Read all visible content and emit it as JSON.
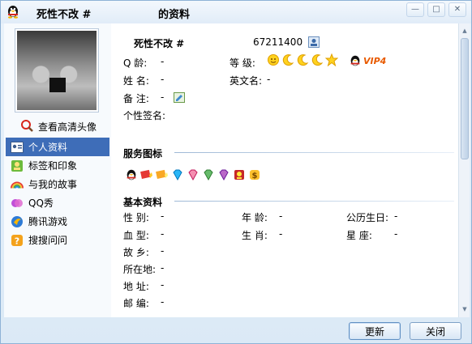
{
  "window": {
    "title_name": "死性不改  #",
    "title_suffix": "的资料",
    "minimize_glyph": "—",
    "maximize_glyph": "□",
    "close_glyph": "✕"
  },
  "sidebar": {
    "view_hd_avatar": "查看高清头像",
    "items": [
      {
        "label": "个人资料",
        "icon": "profile-card-icon",
        "active": true
      },
      {
        "label": "标签和印象",
        "icon": "tag-icon",
        "active": false
      },
      {
        "label": "与我的故事",
        "icon": "rainbow-icon",
        "active": false
      },
      {
        "label": "QQ秀",
        "icon": "qq-show-icon",
        "active": false
      },
      {
        "label": "腾讯游戏",
        "icon": "game-icon",
        "active": false
      },
      {
        "label": "搜搜问问",
        "icon": "question-icon",
        "active": false
      }
    ]
  },
  "profile": {
    "nickname": "死性不改  #",
    "qq_number": "67211400",
    "fields": {
      "age_label": "Q    龄:",
      "age_value": "-",
      "level_label": "等    级:",
      "vip_label": "VIP4",
      "name_label": "姓    名:",
      "name_value": "-",
      "english_name_label": "英文名:",
      "english_name_value": "-",
      "remark_label": "备    注:",
      "remark_value": "-",
      "signature_label": "个性签名:"
    }
  },
  "sections": {
    "service_icons": "服务图标",
    "basic_info": "基本资料"
  },
  "basic_info": {
    "gender_label": "性    别:",
    "gender_value": "-",
    "age_label": "年    龄:",
    "age_value": "-",
    "birthday_label": "公历生日:",
    "birthday_value": "-",
    "blood_label": "血    型:",
    "blood_value": "-",
    "zodiac_label": "生    肖:",
    "zodiac_value": "-",
    "constellation_label": "星       座:",
    "constellation_value": "-",
    "hometown_label": "故    乡:",
    "hometown_value": "-",
    "location_label": "所在地:",
    "location_value": "-",
    "address_label": "地    址:",
    "address_value": "-",
    "postcode_label": "邮    编:",
    "postcode_value": "-"
  },
  "buttons": {
    "refresh": "更新",
    "close": "关闭"
  },
  "colors": {
    "accent": "#3e6db8",
    "vip": "#e85a00"
  }
}
